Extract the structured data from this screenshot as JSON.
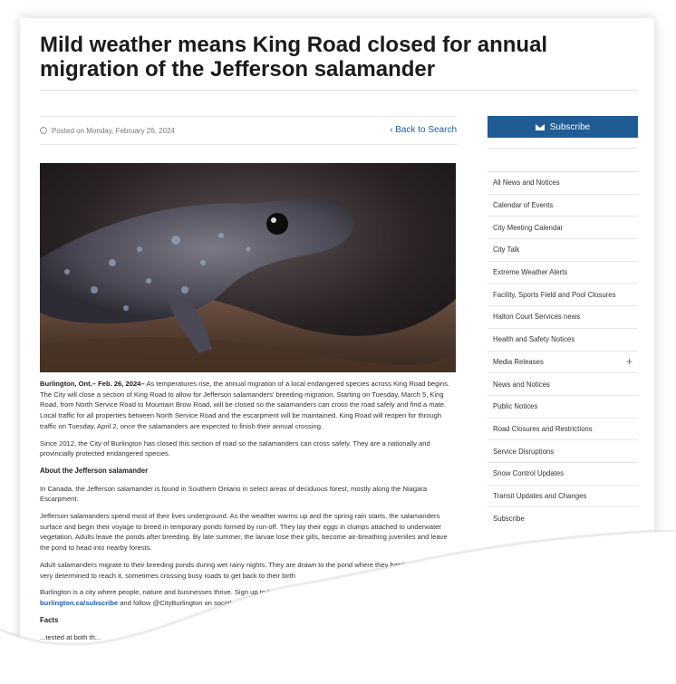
{
  "article": {
    "title": "Mild weather means King Road closed for annual migration of the Jefferson salamander",
    "posted": "Posted on Monday, February 26, 2024",
    "back_label": "Back to Search",
    "lead_bold": "Burlington, Ont.– Feb. 26, 2024–",
    "lead_text": " As temperatures rise, the annual migration of a local endangered species across King Road begins. The City will close a section of King Road to allow for Jefferson salamanders' breeding migration. Starting on Tuesday, March 5, King Road, from North Service Road to Mountain Brow Road, will be closed so the salamanders can cross the road safely and find a mate. Local traffic for all properties between North Service Road and the escarpment will be maintained. King Road will reopen for through traffic on Tuesday, April 2, once the salamanders are expected to finish their annual crossing.",
    "para2": "Since 2012, the City of Burlington has closed this section of road so the salamanders can cross safely. They are a nationally and provincially protected endangered species.",
    "heading_about": "About the Jefferson salamander",
    "para3": "In Canada, the Jefferson salamander is found in Southern Ontario in select areas of deciduous forest, mostly along the Niagara Escarpment.",
    "para4": "Jefferson salamanders spend most of their lives underground. As the weather warms up and the spring rain starts, the salamanders surface and begin their voyage to breed in temporary ponds formed by run-off. They lay their eggs in clumps attached to underwater vegetation. Adults leave the ponds after breeding. By late summer, the larvae lose their gills, become air-breathing juveniles and leave the pond to head into nearby forests.",
    "para5": "Adult salamanders migrate to their breeding ponds during wet rainy nights. They are drawn to the pond where they hatched and can be very determined to reach it, sometimes crossing busy roads to get back to their birth",
    "para6_start": "Burlington is a city where people, nature and businesses thrive. Sign up to learn more about B",
    "subscribe_link": "burlington.ca/subscribe",
    "para6_end": " and follow @CityBurlington on social media.",
    "facts_heading": "Facts",
    "last_line": "...tested at both th..."
  },
  "sidebar": {
    "subscribe_label": "Subscribe",
    "items": [
      {
        "label": "All News and Notices"
      },
      {
        "label": "Calendar of Events"
      },
      {
        "label": "City Meeting Calendar"
      },
      {
        "label": "City Talk"
      },
      {
        "label": "Extreme Weather Alerts"
      },
      {
        "label": "Facility, Sports Field and Pool Closures"
      },
      {
        "label": "Halton Court Services news"
      },
      {
        "label": "Health and Safety Notices"
      },
      {
        "label": "Media Releases",
        "expand": "+"
      },
      {
        "label": "News and Notices"
      },
      {
        "label": "Public Notices"
      },
      {
        "label": "Road Closures and Restrictions"
      },
      {
        "label": "Service Disruptions"
      },
      {
        "label": "Snow Control Updates"
      },
      {
        "label": "Transit Updates and Changes"
      },
      {
        "label": "Subscribe"
      }
    ]
  },
  "colors": {
    "link": "#1b5fa5",
    "subscribe_bg": "#1f5b94"
  },
  "icons": {
    "date": "clock-icon",
    "back": "chevron-left-icon",
    "subscribe": "envelope-icon",
    "expand": "plus-icon"
  }
}
